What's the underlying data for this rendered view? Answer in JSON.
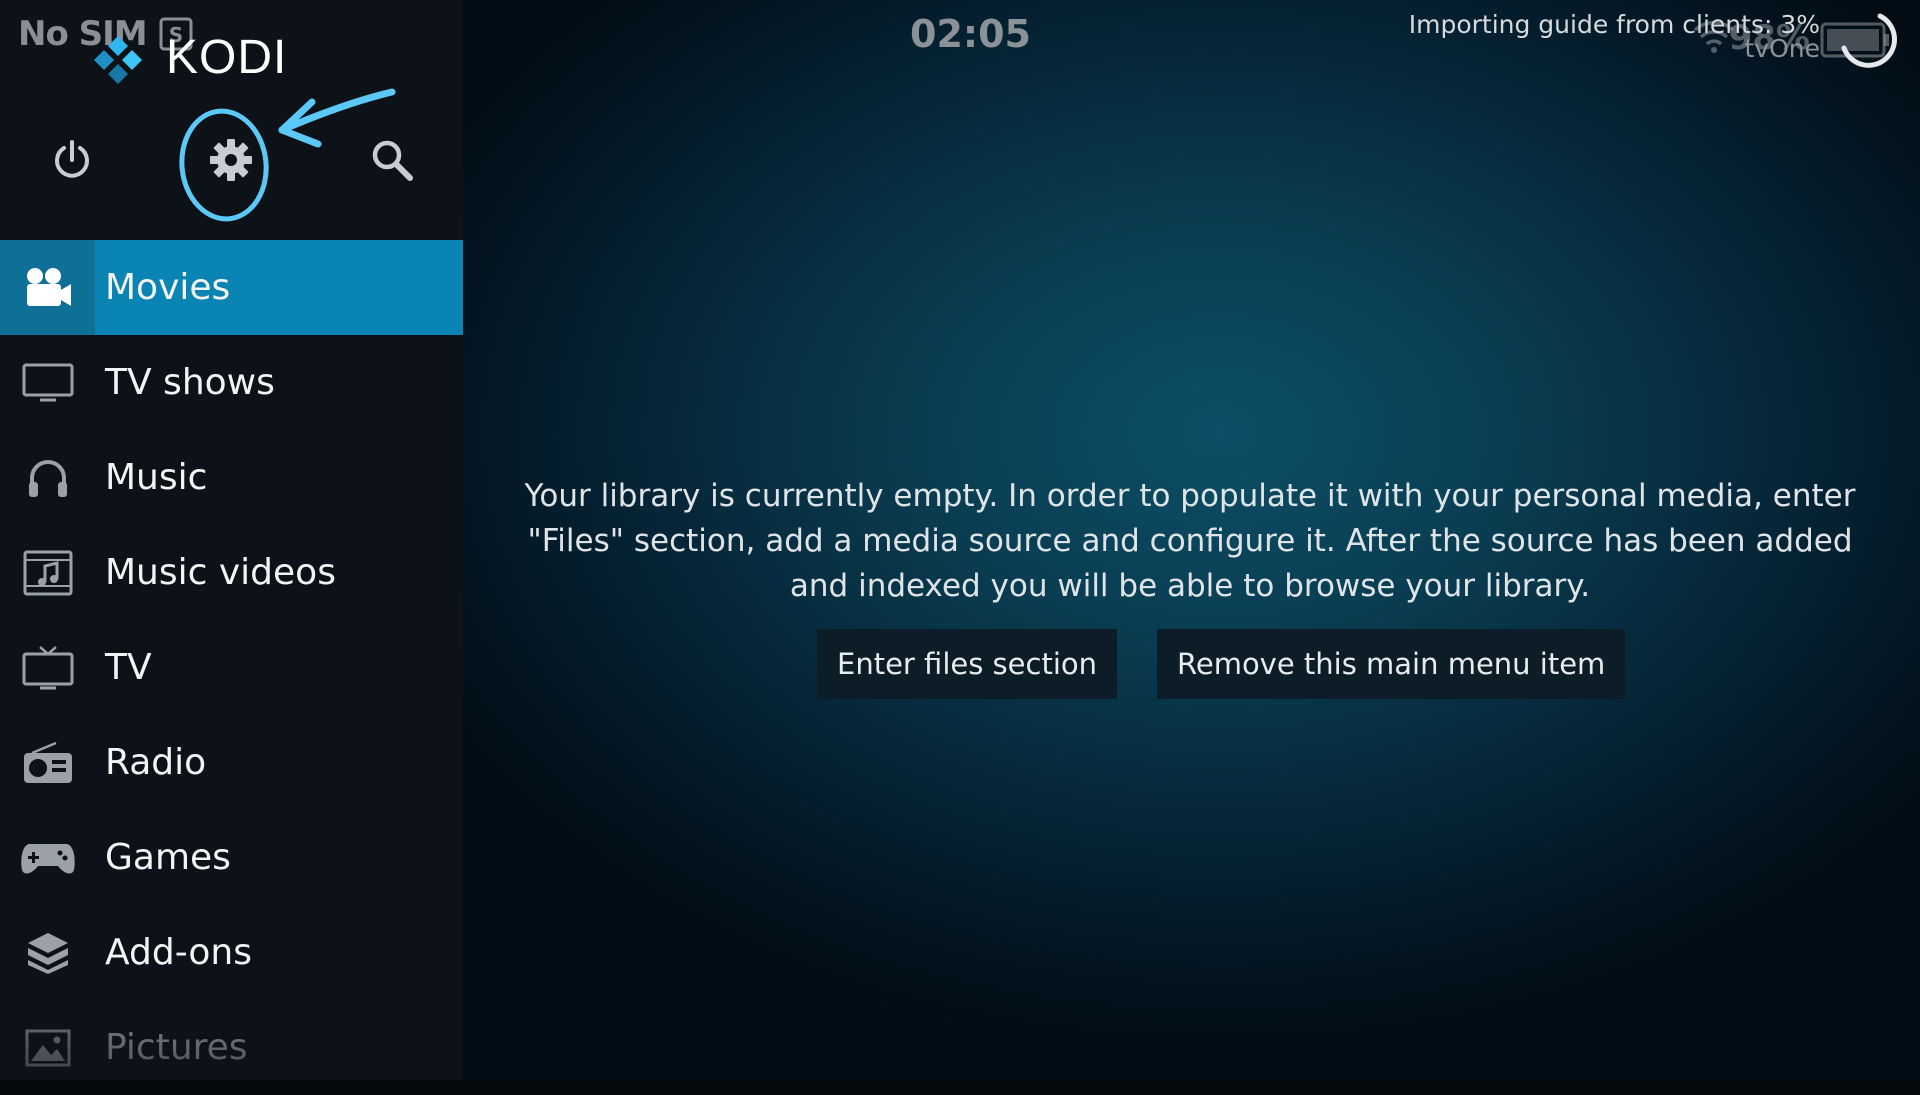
{
  "status_bar": {
    "carrier": "No SIM",
    "clock": "02:05",
    "notification": "Importing guide from clients: 3%",
    "channel": "tvOne",
    "battery": "98%"
  },
  "header": {
    "app_name": "KODI"
  },
  "sidebar": {
    "items": [
      {
        "label": "Movies",
        "icon": "movie-camera-icon",
        "active": true
      },
      {
        "label": "TV shows",
        "icon": "monitor-icon"
      },
      {
        "label": "Music",
        "icon": "headphones-icon"
      },
      {
        "label": "Music videos",
        "icon": "music-video-icon"
      },
      {
        "label": "TV",
        "icon": "tv-icon"
      },
      {
        "label": "Radio",
        "icon": "radio-icon"
      },
      {
        "label": "Games",
        "icon": "gamepad-icon"
      },
      {
        "label": "Add-ons",
        "icon": "addons-box-icon"
      },
      {
        "label": "Pictures",
        "icon": "picture-icon"
      }
    ]
  },
  "main": {
    "message": "Your library is currently empty. In order to populate it with your personal media, enter \"Files\" section, add a media source and configure it. After the source has been added and indexed you will be able to browse your library.",
    "buttons": {
      "enter_files": "Enter files section",
      "remove_item": "Remove this main menu item"
    }
  },
  "colors": {
    "accent": "#0a84b3",
    "annotation": "#5bc8f5"
  }
}
